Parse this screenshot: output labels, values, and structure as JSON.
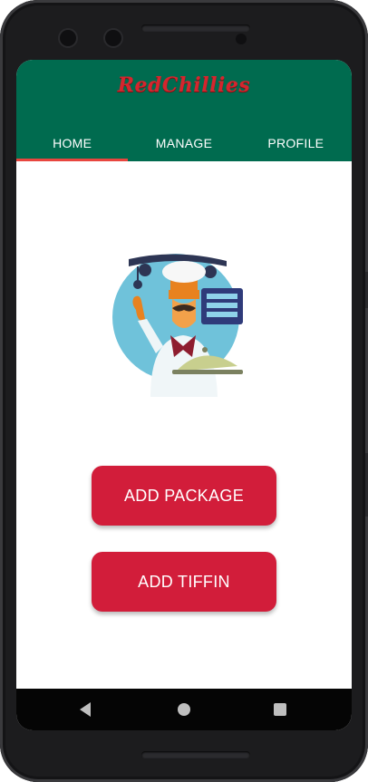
{
  "app": {
    "logo_text": "RedChillies",
    "brand_color": "#006b4f",
    "accent_color": "#d21d3a",
    "indicator_color": "#e8463f"
  },
  "tabs": [
    {
      "label": "HOME",
      "active": true
    },
    {
      "label": "MANAGE",
      "active": false
    },
    {
      "label": "PROFILE",
      "active": false
    }
  ],
  "illustration": {
    "icon": "chef-icon"
  },
  "actions": {
    "add_package_label": "ADD PACKAGE",
    "add_tiffin_label": "ADD TIFFIN"
  },
  "system_nav": {
    "back_icon": "back-icon",
    "home_icon": "home-icon",
    "recents_icon": "recents-icon"
  }
}
